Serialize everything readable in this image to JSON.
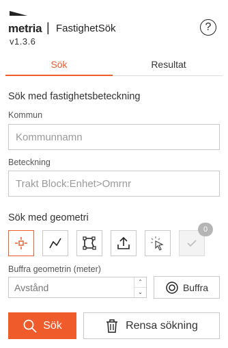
{
  "header": {
    "brand": "metria",
    "separator": "|",
    "app_title": "FastighetSök",
    "version": "v1.3.6",
    "help_label": "?"
  },
  "tabs": [
    {
      "label": "Sök",
      "active": true
    },
    {
      "label": "Resultat",
      "active": false
    }
  ],
  "search_designation": {
    "title": "Sök med fastighetsbeteckning",
    "kommun_label": "Kommun",
    "kommun_placeholder": "Kommunnamn",
    "beteckning_label": "Beteckning",
    "beteckning_placeholder": "Trakt Block:Enhet>Omrnr"
  },
  "search_geometry": {
    "title": "Sök med geometri",
    "tools": [
      {
        "icon": "point-icon",
        "active": true
      },
      {
        "icon": "polyline-icon",
        "active": false
      },
      {
        "icon": "polygon-icon",
        "active": false
      },
      {
        "icon": "upload-icon",
        "active": false
      },
      {
        "icon": "select-icon",
        "active": false
      },
      {
        "icon": "check-icon",
        "disabled": true
      }
    ],
    "selected_count": "0",
    "buffer_label": "Buffra geometrin (meter)",
    "buffer_placeholder": "Avstånd",
    "buffer_button": "Buffra"
  },
  "actions": {
    "search": "Sök",
    "clear": "Rensa sökning"
  },
  "colors": {
    "accent": "#ef5b2b",
    "border": "#c8c8c8"
  }
}
